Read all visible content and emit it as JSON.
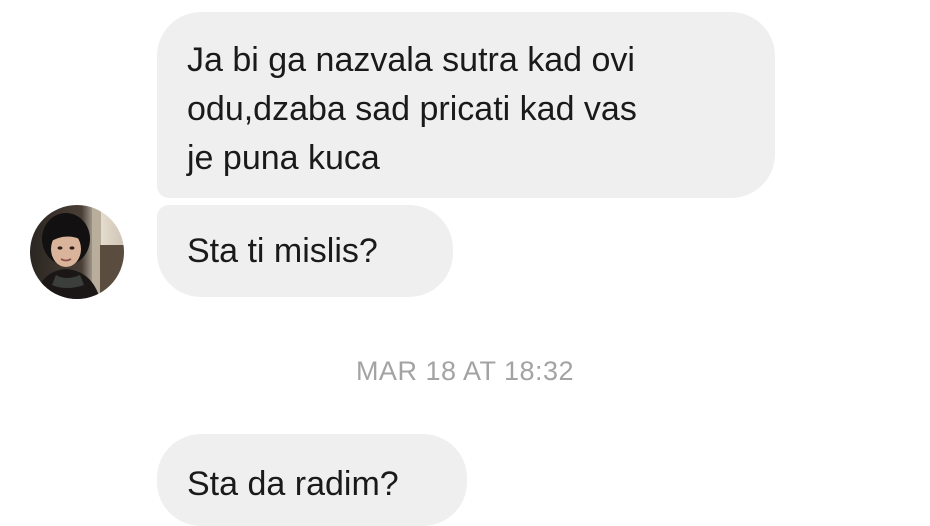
{
  "messages": [
    {
      "text_lines": [
        "Ja bi ga nazvala sutra kad ovi",
        "odu,dzaba sad pricati kad vas",
        "je puna kuca"
      ]
    },
    {
      "text_lines": [
        "Sta ti mislis?"
      ]
    },
    {
      "text_lines": [
        "Sta da radim?"
      ]
    }
  ],
  "timestamp": "MAR 18 AT 18:32",
  "colors": {
    "bubble_background": "#efefef",
    "message_text": "#1a1a1a",
    "timestamp_text": "#a3a3a3",
    "page_background": "#ffffff"
  },
  "avatar": {
    "icon": "contact-avatar-photo"
  }
}
